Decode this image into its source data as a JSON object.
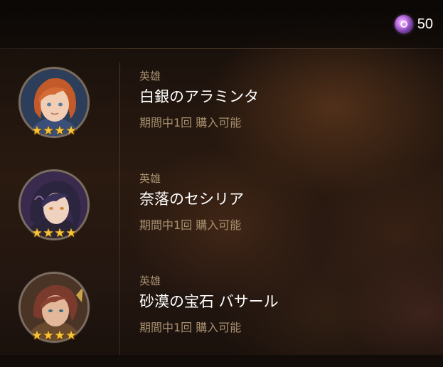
{
  "currency": {
    "icon": "gem-icon",
    "value": "50",
    "color": "#c77ae6"
  },
  "heroes": [
    {
      "category": "英雄",
      "name": "白銀のアラミンタ",
      "limit": "期間中1回 購入可能",
      "stars": 4,
      "portrait": "hero-portrait-araminta-icon"
    },
    {
      "category": "英雄",
      "name": "奈落のセシリア",
      "limit": "期間中1回 購入可能",
      "stars": 4,
      "portrait": "hero-portrait-cecilia-icon"
    },
    {
      "category": "英雄",
      "name": "砂漠の宝石 バサール",
      "limit": "期間中1回 購入可能",
      "stars": 4,
      "portrait": "hero-portrait-basar-icon"
    }
  ],
  "colors": {
    "accent": "#a8906f",
    "star": "#f6c53a",
    "text": "#ffffff"
  }
}
